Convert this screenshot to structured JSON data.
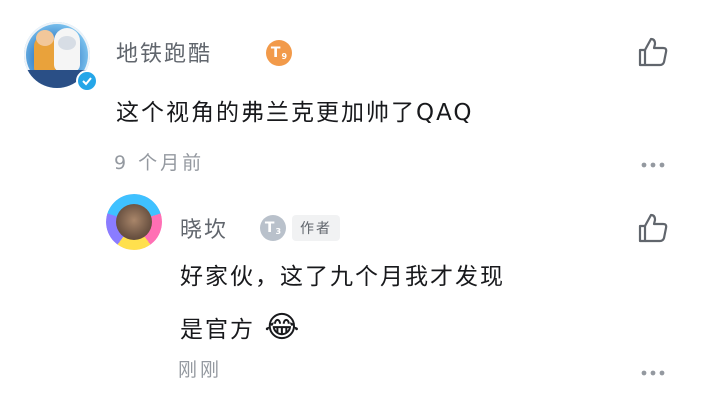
{
  "comment": {
    "username": "地铁跑酷",
    "level": "T",
    "level_sub": "9",
    "level_color": "#f29a4a",
    "text": "这个视角的弗兰克更加帅了QAQ",
    "time": "9 个月前",
    "verified_color": "#25a6e8"
  },
  "reply": {
    "username": "晓坎",
    "level": "T",
    "level_sub": "3",
    "level_color": "#b9c1cb",
    "author_tag": "作者",
    "text_line1": "好家伙，这了九个月我才发现",
    "text_line2": "是官方",
    "emoji": "😂",
    "time": "刚刚"
  },
  "icons": {
    "like": "thumbs-up-icon",
    "more": "more-dots-icon",
    "verified": "check-icon"
  }
}
